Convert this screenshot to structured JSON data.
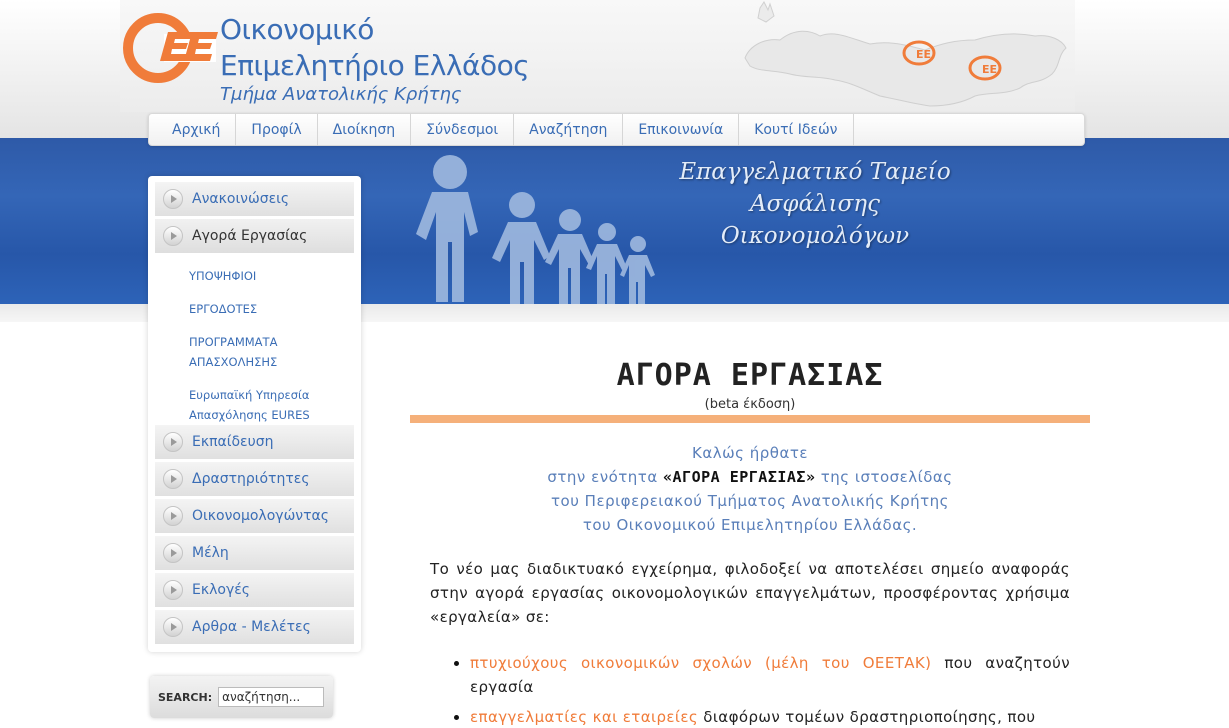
{
  "colors": {
    "link": "#3a6db5",
    "accent": "#f07c3a",
    "rule": "#f5b07a",
    "banner": "#2e5aa8"
  },
  "header": {
    "title_line1": "Οικονομικό",
    "title_line2": "Επιμελητήριο Ελλάδος",
    "subtitle": "Τμήμα Ανατολικής Κρήτης"
  },
  "nav": [
    "Αρχική",
    "Προφίλ",
    "Διοίκηση",
    "Σύνδεσμοι",
    "Αναζήτηση",
    "Επικοινωνία",
    "Κουτί Ιδεών"
  ],
  "banner": {
    "line1": "Επαγγελματικό Ταμείο",
    "line2": "Ασφάλισης",
    "line3": "Οικονομολόγων"
  },
  "sidebar": {
    "items": [
      "Ανακοινώσεις",
      "Αγορά Εργασίας",
      "Εκπαίδευση",
      "Δραστηριότητες",
      "Οικονομολογώντας",
      "Μέλη",
      "Εκλογές",
      "Αρθρα - Μελέτες"
    ],
    "sub": [
      "ΥΠΟΨΗΦΙΟΙ",
      "ΕΡΓΟΔΟΤΕΣ",
      "ΠΡΟΓΡΑΜΜΑΤΑ ΑΠΑΣΧΟΛΗΣΗΣ",
      "Ευρωπαϊκή Υπηρεσία Απασχόλησης EURES"
    ]
  },
  "search": {
    "label": "SEARCH:",
    "value": "αναζήτηση..."
  },
  "main": {
    "title": "ΑΓΟΡΑ ΕΡΓΑΣΙΑΣ",
    "subtitle": "(beta έκδοση)",
    "welcome1": "Καλώς ήρθατε",
    "welcome2a": "στην ενότητα",
    "welcome2b": "«ΑΓΟΡΑ ΕΡΓΑΣΙΑΣ»",
    "welcome2c": "της ιστοσελίδας",
    "welcome3": "του Περιφερειακού Τμήματος Ανατολικής Κρήτης",
    "welcome4": "του Οικονομικού Επιμελητηρίου Ελλάδας.",
    "intro": "Το νέο μας διαδικτυακό εγχείρημα, φιλοδοξεί να αποτελέσει σημείο αναφοράς στην αγορά εργασίας οικονομολογικών επαγγελμάτων, προσφέροντας χρήσιμα «εργαλεία» σε:",
    "bullet1_link": "πτυχιούχους οικονομικών σχολών (μέλη του ΟΕΕΤΑΚ)",
    "bullet1_rest": "που αναζητούν εργασία",
    "bullet2_link": "επαγγελματίες και εταιρείες",
    "bullet2_rest": "διαφόρων τομέων δραστηριοποίησης, που"
  }
}
